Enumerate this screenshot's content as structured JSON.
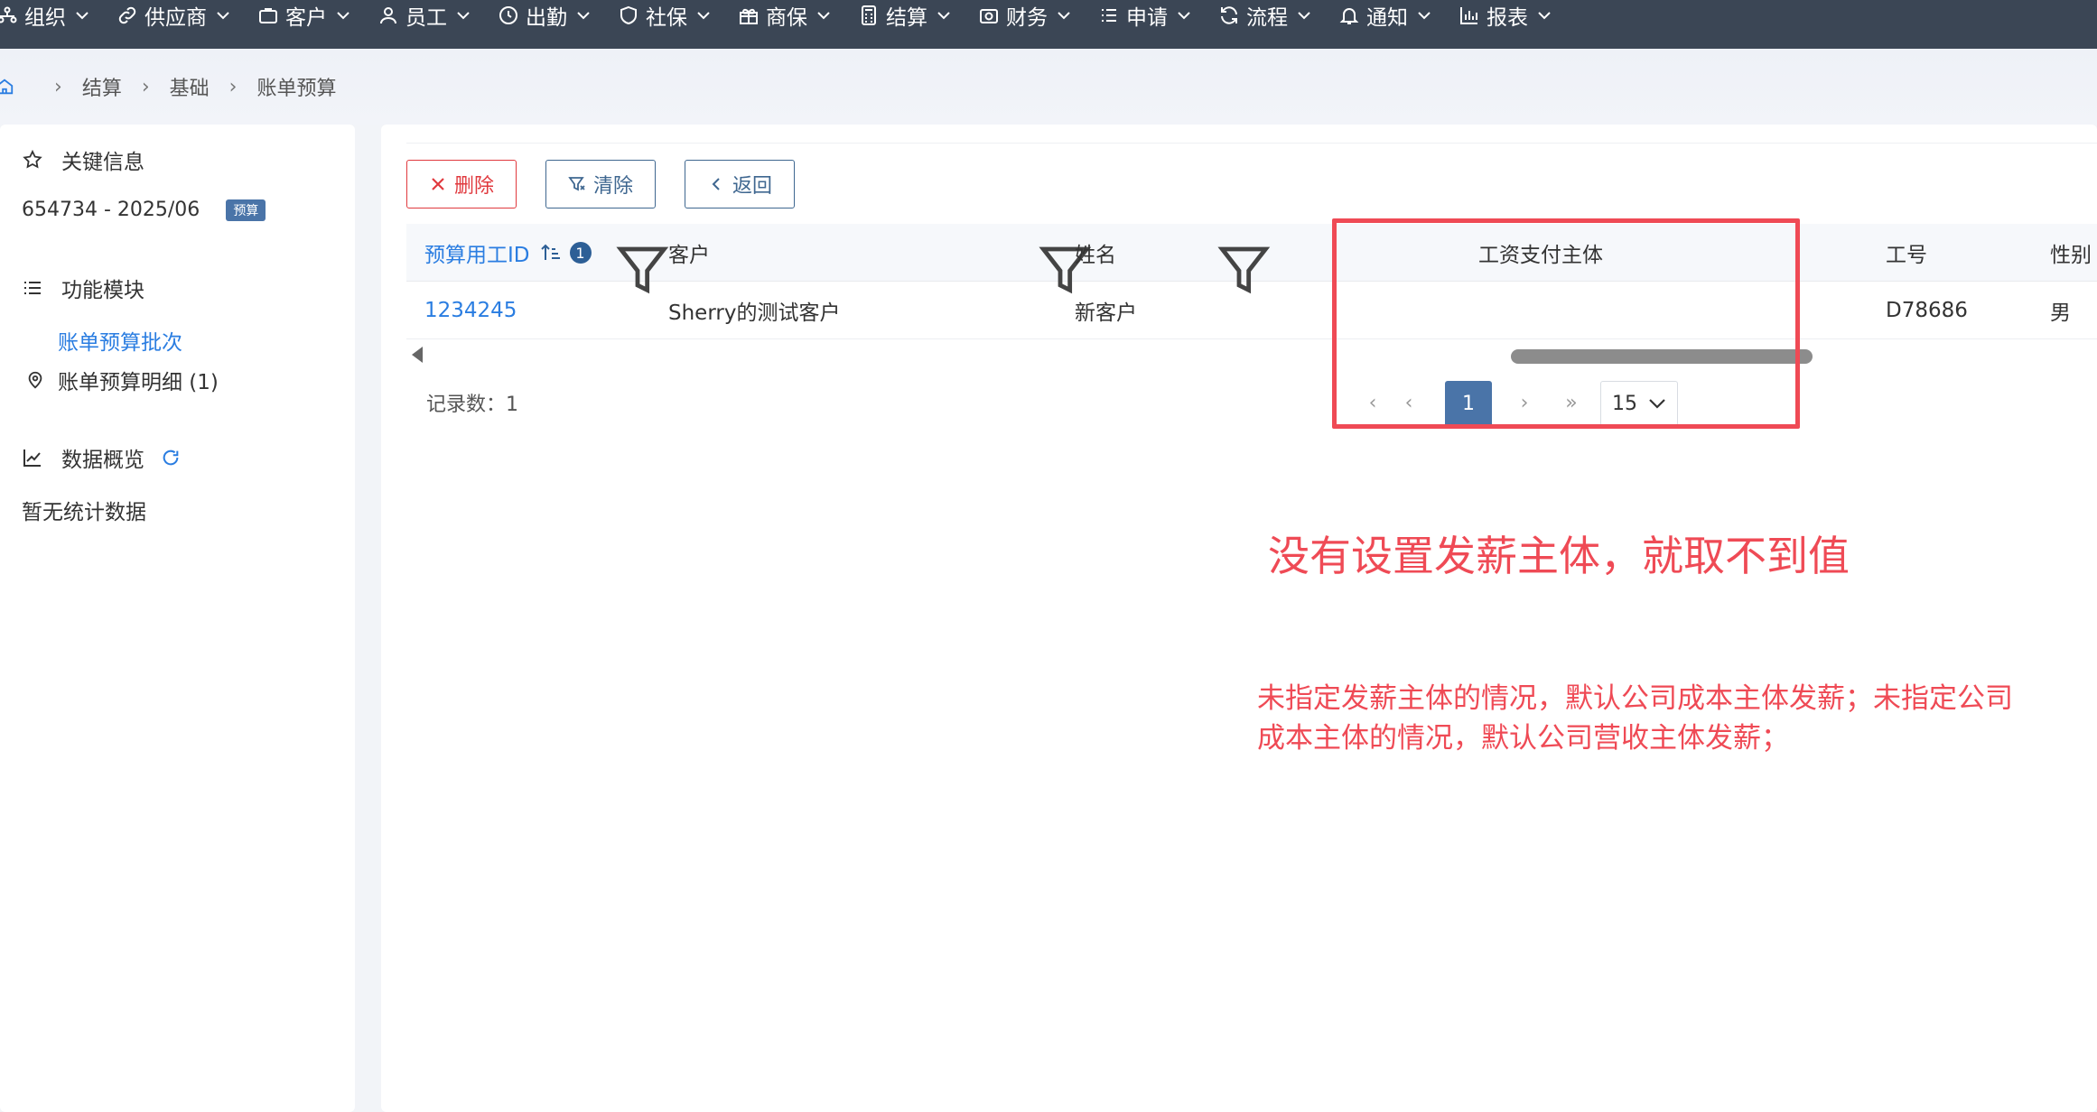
{
  "nav": {
    "items": [
      {
        "label": "组织",
        "icon": "org-icon"
      },
      {
        "label": "供应商",
        "icon": "link-icon"
      },
      {
        "label": "客户",
        "icon": "briefcase-icon"
      },
      {
        "label": "员工",
        "icon": "user-icon"
      },
      {
        "label": "出勤",
        "icon": "clock-icon"
      },
      {
        "label": "社保",
        "icon": "shield-icon"
      },
      {
        "label": "商保",
        "icon": "gift-icon"
      },
      {
        "label": "结算",
        "icon": "calculator-icon"
      },
      {
        "label": "财务",
        "icon": "camera-icon"
      },
      {
        "label": "申请",
        "icon": "list-icon"
      },
      {
        "label": "流程",
        "icon": "refresh-icon"
      },
      {
        "label": "通知",
        "icon": "bell-icon"
      },
      {
        "label": "报表",
        "icon": "bar-chart-icon"
      }
    ]
  },
  "breadcrumb": {
    "items": [
      "结算",
      "基础",
      "账单预算"
    ]
  },
  "left": {
    "key_info_title": "关键信息",
    "record_id": "654734 - 2025/06",
    "record_badge": "预算",
    "modules_title": "功能模块",
    "module_active": "账单预算批次",
    "module_detail": "账单预算明细 (1)",
    "overview_title": "数据概览",
    "overview_empty": "暂无统计数据"
  },
  "toolbar": {
    "delete_label": "删除",
    "clear_label": "清除",
    "back_label": "返回"
  },
  "table": {
    "columns": {
      "id": "预算用工ID",
      "id_filter_count": "1",
      "customer": "客户",
      "name": "姓名",
      "pay_entity": "工资支付主体",
      "emp_no": "工号",
      "gender": "性别"
    },
    "rows": [
      {
        "id": "1234245",
        "customer": "Sherry的测试客户",
        "name": "新客户",
        "pay_entity": "",
        "emp_no": "D78686",
        "gender": "男"
      }
    ]
  },
  "footer": {
    "record_count": "记录数：1",
    "current_page": "1",
    "page_size": "15"
  },
  "annotation": {
    "title": "没有设置发薪主体，就取不到值",
    "body": "未指定发薪主体的情况，默认公司成本主体发薪；未指定公司成本主体的情况，默认公司营收主体发薪；",
    "color": "#ef4a55"
  },
  "colors": {
    "nav_bg": "#3b4655",
    "accent": "#4a74a8",
    "link": "#2a7de1",
    "danger": "#e0393e"
  }
}
